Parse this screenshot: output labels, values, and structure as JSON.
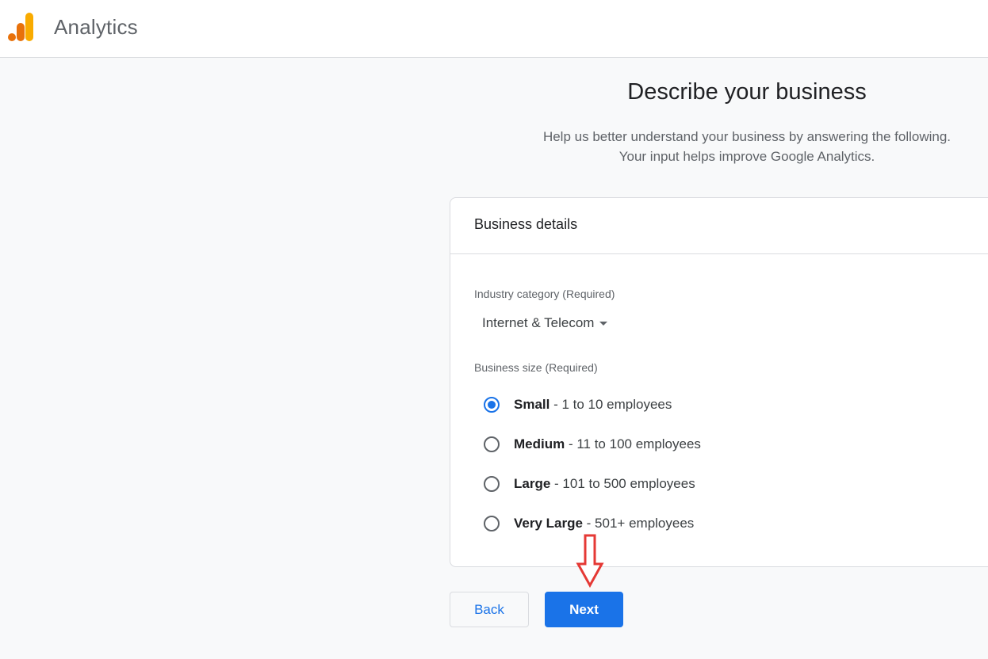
{
  "app": {
    "title": "Analytics"
  },
  "page": {
    "title": "Describe your business",
    "subtitle_line1": "Help us better understand your business by answering the following.",
    "subtitle_line2": "Your input helps improve Google Analytics."
  },
  "card": {
    "header": "Business details",
    "industry": {
      "label": "Industry category (Required)",
      "value": "Internet & Telecom"
    },
    "size": {
      "label": "Business size (Required)",
      "selected": "Small",
      "options": [
        {
          "name": "Small",
          "desc": " - 1 to 10 employees"
        },
        {
          "name": "Medium",
          "desc": " - 11 to 100 employees"
        },
        {
          "name": "Large",
          "desc": " - 101 to 500 employees"
        },
        {
          "name": "Very Large",
          "desc": " - 501+ employees"
        }
      ]
    }
  },
  "buttons": {
    "back": "Back",
    "next": "Next"
  },
  "colors": {
    "accent": "#1a73e8",
    "logo_orange": "#e8710a",
    "logo_yellow": "#f9ab00",
    "annotation_arrow": "#e53935"
  },
  "icons": {
    "logo": "analytics-logo-icon",
    "dropdown": "caret-down-icon",
    "annotation": "down-arrow-icon"
  }
}
